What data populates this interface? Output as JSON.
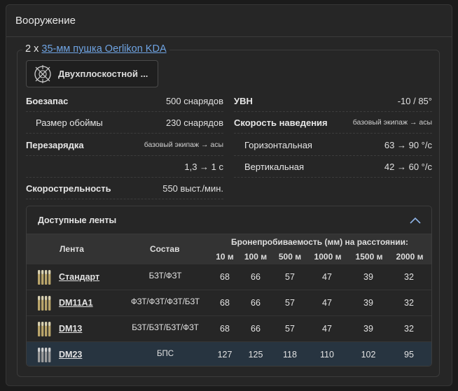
{
  "panel": {
    "title": "Вооружение"
  },
  "weapon": {
    "count_prefix": "2 x",
    "name_link": "35-мм пушка Oerlikon KDA",
    "mode_button": "Двухплоскостной ..."
  },
  "stats_left": [
    {
      "label": "Боезапас",
      "value": "500 снарядов"
    },
    {
      "label": "Размер обоймы",
      "value": "230 снарядов"
    },
    {
      "label": "Перезарядка",
      "value": "базовый экипаж → асы"
    },
    {
      "label": "",
      "value": "1,3 → 1 с"
    },
    {
      "label": "Скорострельность",
      "value": "550 выст./мин."
    }
  ],
  "stats_right": [
    {
      "label": "УВН",
      "value": "-10 / 85°"
    },
    {
      "label": "Скорость наведения",
      "value": "базовый экипаж → асы"
    },
    {
      "label": "Горизонтальная",
      "value": "63 → 90 °/c"
    },
    {
      "label": "Вертикальная",
      "value": "42 → 60 °/c"
    }
  ],
  "belts": {
    "title": "Доступные ленты",
    "col_belt": "Лента",
    "col_composition": "Состав",
    "col_penetration": "Бронепробиваемость (мм) на расстоянии:",
    "distances": [
      "10 м",
      "100 м",
      "500 м",
      "1000 м",
      "1500 м",
      "2000 м"
    ],
    "rows": [
      {
        "name": "Стандарт",
        "composition": "БЗТ/ФЗТ",
        "values": [
          "68",
          "66",
          "57",
          "47",
          "39",
          "32"
        ]
      },
      {
        "name": "DM11A1",
        "composition": "ФЗТ/ФЗТ/ФЗТ/БЗТ",
        "values": [
          "68",
          "66",
          "57",
          "47",
          "39",
          "32"
        ]
      },
      {
        "name": "DM13",
        "composition": "БЗТ/БЗТ/БЗТ/ФЗТ",
        "values": [
          "68",
          "66",
          "57",
          "47",
          "39",
          "32"
        ]
      },
      {
        "name": "DM23",
        "composition": "БПС",
        "values": [
          "127",
          "125",
          "118",
          "110",
          "102",
          "95"
        ]
      }
    ]
  },
  "colors": {
    "link": "#6fa4e3",
    "selected_row": "#273440",
    "accent": "#8fb4e6"
  }
}
